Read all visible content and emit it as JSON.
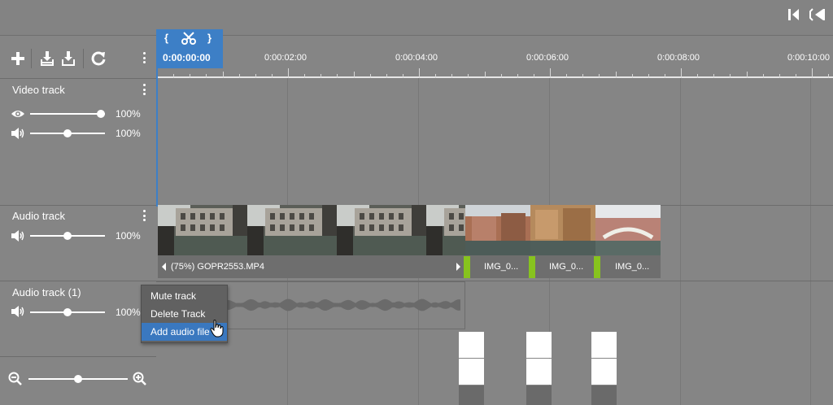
{
  "toolbar": {
    "icons": [
      "plus-icon",
      "split-track-icon",
      "merge-track-icon",
      "redo-icon",
      "more-icon"
    ],
    "nav_icons": [
      "skip-to-start-icon",
      "step-back-icon"
    ]
  },
  "playhead": {
    "time": "0:00:00:00",
    "left_brace": "{",
    "right_brace": "}"
  },
  "ruler": {
    "labels": [
      "0:00:02:00",
      "0:00:04:00",
      "0:00:06:00",
      "0:00:08:00",
      "0:00:10:00"
    ]
  },
  "tracks": [
    {
      "name": "Video track",
      "controls": [
        {
          "icon": "eye-icon",
          "value_percent": 100,
          "label": "100%"
        },
        {
          "icon": "speaker-icon",
          "value_percent": 50,
          "label": "100%"
        }
      ]
    },
    {
      "name": "Audio track",
      "controls": [
        {
          "icon": "speaker-icon",
          "value_percent": 50,
          "label": "100%"
        }
      ]
    },
    {
      "name": "Audio track (1)",
      "controls": [
        {
          "icon": "speaker-icon",
          "value_percent": 50,
          "label": "100%"
        }
      ]
    }
  ],
  "clips": [
    {
      "label": "(75%) GOPR2553.MP4"
    },
    {
      "label": "IMG_0..."
    },
    {
      "label": "IMG_0..."
    },
    {
      "label": "IMG_0..."
    }
  ],
  "context_menu": {
    "items": [
      "Mute track",
      "Delete Track",
      "Add audio file"
    ],
    "highlighted_index": 2
  },
  "zoom": {
    "level_fraction": 0.5
  },
  "colors": {
    "accent": "#3d7fc6",
    "marker_green": "#87c31e",
    "background": "#858585"
  }
}
